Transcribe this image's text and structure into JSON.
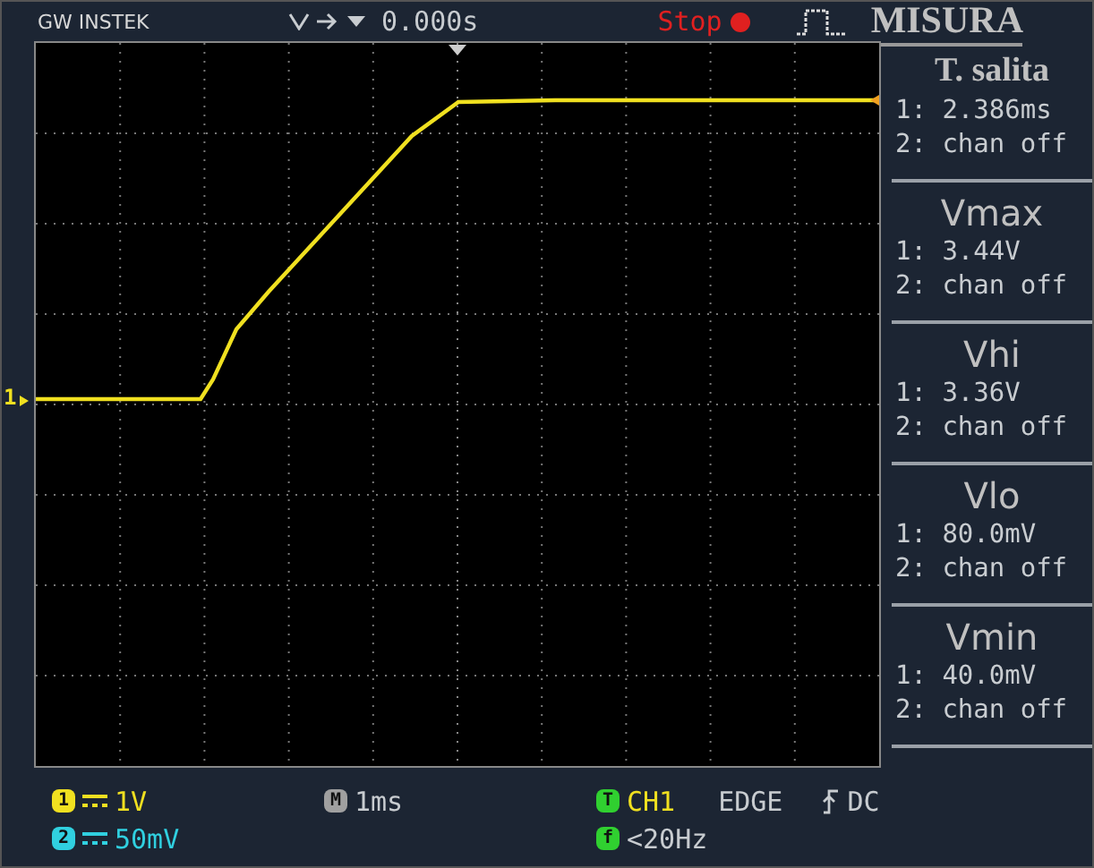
{
  "header": {
    "brand": "GW INSTEK",
    "trigger_position": "0.000s",
    "run_state": "Stop",
    "panel_title": "MISURA"
  },
  "channel_marker": "1",
  "measurements": [
    {
      "kind": "custom",
      "name": "T. salita",
      "ch1": "1: 2.386ms",
      "ch2": "2: chan off"
    },
    {
      "kind": "standard",
      "name": "Vmax",
      "ch1": "1: 3.44V",
      "ch2": "2: chan off"
    },
    {
      "kind": "standard",
      "name": "Vhi",
      "ch1": "1: 3.36V",
      "ch2": "2: chan off"
    },
    {
      "kind": "standard",
      "name": "Vlo",
      "ch1": "1: 80.0mV",
      "ch2": "2: chan off"
    },
    {
      "kind": "standard",
      "name": "Vmin",
      "ch1": "1: 40.0mV",
      "ch2": "2: chan off"
    }
  ],
  "footer": {
    "channels": [
      {
        "badge": "1",
        "scale": "1V",
        "color": "#f0e020"
      },
      {
        "badge": "2",
        "scale": "50mV",
        "color": "#30d0e0"
      }
    ],
    "timebase": {
      "badge": "M",
      "value": "1ms"
    },
    "trigger": {
      "badge": "T",
      "source": "CH1",
      "type": "EDGE",
      "coupling": "DC"
    },
    "filter": {
      "badge": "f",
      "value": "<20Hz"
    }
  }
}
